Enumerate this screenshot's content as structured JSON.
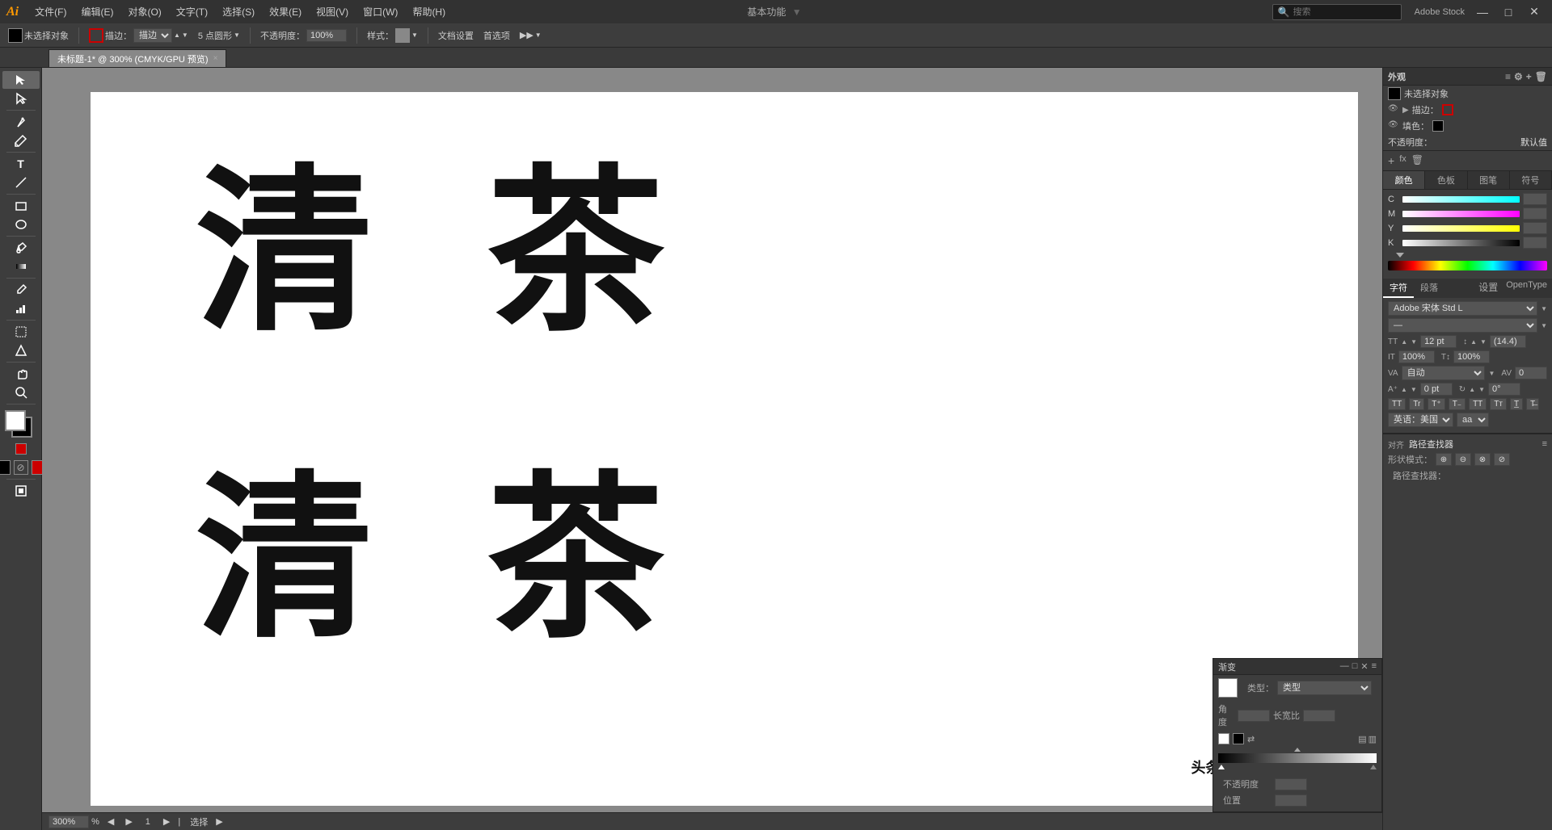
{
  "app": {
    "logo": "Ai",
    "title": "基本功能"
  },
  "menu": {
    "items": [
      "文件(F)",
      "编辑(E)",
      "对象(O)",
      "文字(T)",
      "选择(S)",
      "效果(E)",
      "视图(V)",
      "窗口(W)",
      "帮助(H)"
    ]
  },
  "toolbar": {
    "no_selection": "未选择对象",
    "stroke_label": "描边：",
    "size_label": "5 点圆形",
    "opacity_label": "不透明度：",
    "opacity_value": "100%",
    "style_label": "样式：",
    "doc_setup": "文档设置",
    "prefs": "首选项"
  },
  "tab": {
    "title": "未标题-1* @ 300% (CMYK/GPU 预览)",
    "close": "×"
  },
  "canvas": {
    "zoom": "300%",
    "page": "1",
    "mode": "选择",
    "chars_top_left": "清",
    "chars_top_right": "茶",
    "chars_bottom_left": "清",
    "chars_bottom_right": "茶",
    "watermark": "头条 @花花平面设计"
  },
  "appearance_panel": {
    "title": "外观",
    "no_selection": "未选择对象",
    "stroke_label": "描边：",
    "fill_label": "填色：",
    "opacity_label": "不透明度：",
    "opacity_value": "默认值"
  },
  "panel_tabs": {
    "items": [
      "颜色",
      "色板",
      "图笔",
      "符号"
    ]
  },
  "color_panel": {
    "letters": [
      "C",
      "M",
      "Y",
      "K"
    ],
    "values": [
      "",
      "",
      "",
      ""
    ]
  },
  "char_panel": {
    "tabs": [
      "字符",
      "段落"
    ],
    "font_name": "Adobe 宋体 Std L",
    "size_value": "12 pt",
    "leading_value": "(14.4)",
    "scale_h": "100%",
    "scale_v": "100%",
    "tracking_value": "0%",
    "kerning_label": "自动",
    "kerning_value": "自动",
    "baseline_value": "0 pt",
    "rotate_value": "0°",
    "language": "英语：美国",
    "align_label": "对齐",
    "align_value": "路径查找器",
    "shape_label": "形状模式：",
    "path_label": "路径查找器："
  },
  "gradient_panel": {
    "title": "渐变",
    "type_label": "类型：",
    "opacity_label": "不透明度",
    "location_label": "位置"
  },
  "right_panel_tabs": {
    "items": [
      "设置",
      "OpenType"
    ]
  }
}
